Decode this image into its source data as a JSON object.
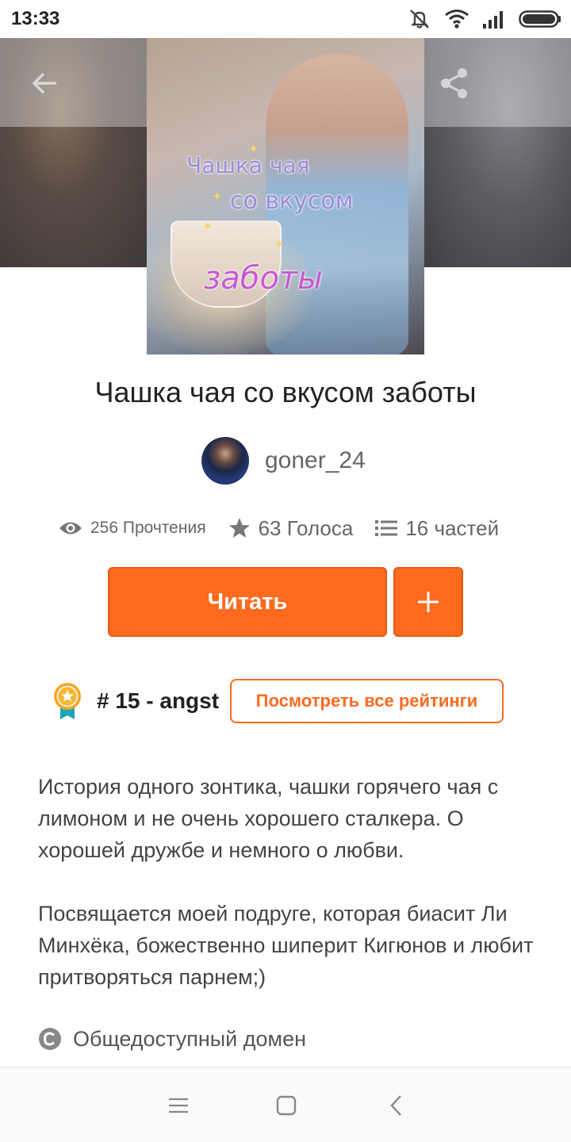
{
  "status_bar": {
    "time": "13:33"
  },
  "cover": {
    "line1": "Чашка чая",
    "line2": "со вкусом",
    "line3": "заботы"
  },
  "book": {
    "title": "Чашка чая со вкусом заботы",
    "author": "goner_24"
  },
  "stats": {
    "reads": "256 Прочтения",
    "votes": "63 Голоса",
    "parts": "16 частей"
  },
  "actions": {
    "read_label": "Читать",
    "add_label": "+"
  },
  "ranking": {
    "rank": "# 15 - angst",
    "view_all_label": "Посмотреть все рейтинги"
  },
  "description": {
    "paragraph1": "История одного зонтика, чашки горячего чая с лимоном и не очень хорошего сталкера. О хорошей дружбе и немного о любви.",
    "paragraph2": "Посвящается моей подруге, которая биасит Ли Минхёка, божественно шиперит Кигюнов и любит притворяться парнем;)"
  },
  "license": {
    "label": "Общедоступный домен"
  },
  "colors": {
    "accent": "#ff6a1f",
    "text": "#222222",
    "muted": "#666666"
  }
}
